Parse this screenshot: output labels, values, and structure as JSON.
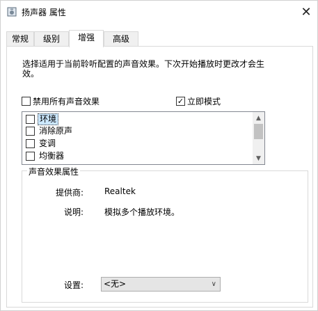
{
  "window": {
    "title": "扬声器 属性",
    "close_glyph": "✕"
  },
  "tabs": [
    {
      "label": "常规"
    },
    {
      "label": "级别"
    },
    {
      "label": "增强",
      "active": true
    },
    {
      "label": "高级"
    }
  ],
  "enhancements": {
    "description": "选择适用于当前聆听配置的声音效果。下次开始播放时更改才会生效。",
    "disable_all": {
      "label": "禁用所有声音效果",
      "checked": false
    },
    "immediate_mode": {
      "label": "立即模式",
      "checked": true
    },
    "list_items": [
      {
        "label": "环境",
        "checked": false,
        "selected": true
      },
      {
        "label": "消除原声",
        "checked": false
      },
      {
        "label": "变调",
        "checked": false
      },
      {
        "label": "均衡器",
        "checked": false
      }
    ]
  },
  "properties": {
    "group_title": "声音效果属性",
    "provider_label": "提供商:",
    "provider_value": "Realtek",
    "description_label": "说明:",
    "description_value": "模拟多个播放环境。",
    "settings_label": "设置:",
    "settings_value": "<无>"
  },
  "colors": {
    "selection": "#cce8ff",
    "border": "#d9d9d9"
  }
}
